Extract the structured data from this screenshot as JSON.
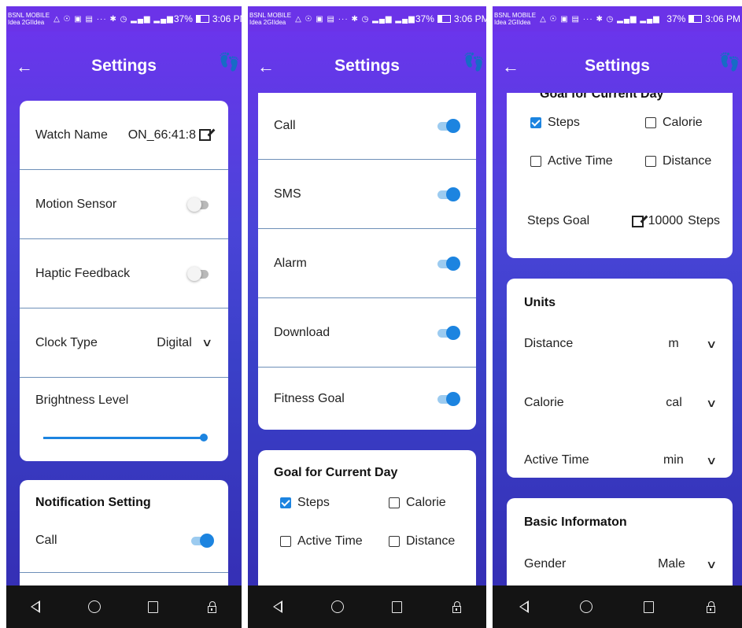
{
  "status_bar": {
    "carrier_line1": "BSNL MOBILE",
    "carrier_line2": "Idea 2GIIdea",
    "icons": "△ ☉ ▣ ▤ ··· ✱ ◷ ▂▄▆ ▂▄▆",
    "battery_percent": "37%",
    "time": "3:06 PM"
  },
  "appbar": {
    "title": "Settings",
    "back_glyph": "←",
    "steps_icon_glyph": "👣"
  },
  "panel1": {
    "rows": [
      {
        "label": "Watch Name",
        "value": "ON_66:41:8"
      },
      {
        "label": "Motion Sensor",
        "toggle": false
      },
      {
        "label": "Haptic Feedback",
        "toggle": false
      },
      {
        "label": "Clock Type",
        "value": "Digital"
      }
    ],
    "brightness_label": "Brightness Level",
    "brightness_value": 1.0,
    "notification_title": "Notification Setting",
    "notification_first": "Call"
  },
  "panel2": {
    "rows": [
      {
        "label": "Call",
        "toggle": true
      },
      {
        "label": "SMS",
        "toggle": true
      },
      {
        "label": "Alarm",
        "toggle": true
      },
      {
        "label": "Download",
        "toggle": true
      },
      {
        "label": "Fitness Goal",
        "toggle": true
      }
    ],
    "goal_title": "Goal for Current Day",
    "goal_options": [
      {
        "label": "Steps",
        "checked": true
      },
      {
        "label": "Calorie",
        "checked": false
      },
      {
        "label": "Active Time",
        "checked": false
      },
      {
        "label": "Distance",
        "checked": false
      }
    ]
  },
  "panel3": {
    "goal_title_cut": "Goal for Current Day",
    "goal_options": [
      {
        "label": "Steps",
        "checked": true
      },
      {
        "label": "Calorie",
        "checked": false
      },
      {
        "label": "Active Time",
        "checked": false
      },
      {
        "label": "Distance",
        "checked": false
      }
    ],
    "steps_goal_label": "Steps Goal",
    "steps_goal_value": "10000",
    "steps_goal_unit": "Steps",
    "units_title": "Units",
    "units": [
      {
        "label": "Distance",
        "value": "m"
      },
      {
        "label": "Calorie",
        "value": "cal"
      },
      {
        "label": "Active Time",
        "value": "min"
      }
    ],
    "basic_title": "Basic Informaton",
    "gender_label": "Gender",
    "gender_value": "Male"
  },
  "chevron_glyph": "⌄",
  "colors": {
    "accent": "#1c84e0",
    "header": "#6b33e8",
    "navbar": "#141414"
  }
}
